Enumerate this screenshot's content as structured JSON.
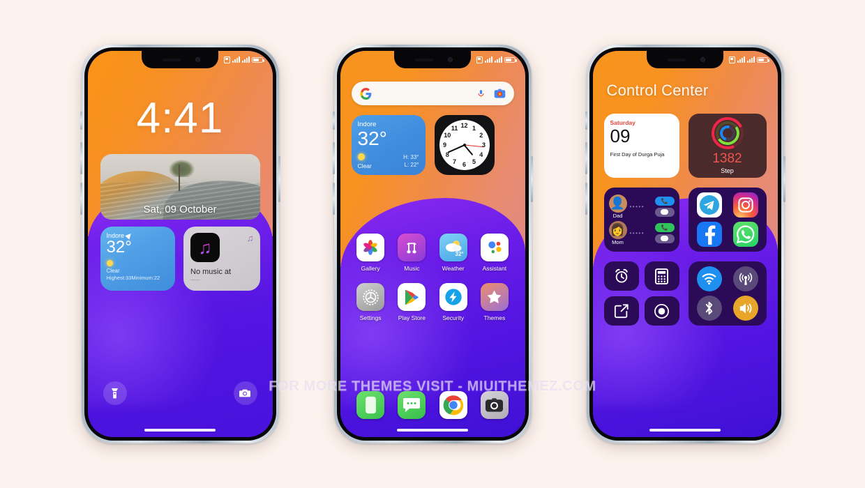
{
  "watermark": "FOR MORE THEMES VISIT - MIUITHEMEZ.COM",
  "colors": {
    "page_background": "#FDF3EE",
    "wallpaper_orange": "#F7941D",
    "wallpaper_purple": "#5415E2",
    "accent_blue": "#3F8CDD",
    "accent_red": "#E0483E",
    "toggle_on_blue": "#1E90F0",
    "toggle_on_orange": "#E8A52A"
  },
  "lock_screen": {
    "name": "Lock Screen",
    "status_bar": {
      "sim_icon": "sim-icon",
      "signal_icon": "signal-bars-icon",
      "battery_icon": "battery-icon"
    },
    "time": "4:41",
    "photo_widget": {
      "date": "Sat, 09 October"
    },
    "weather_widget": {
      "city": "Indore",
      "location_icon": "location-arrow-icon",
      "temperature": "32°",
      "condition_icon": "sun-icon",
      "condition": "Clear",
      "high_low": "Highest:33Minimum:22"
    },
    "music_widget": {
      "app_icon": "music-note-icon",
      "badge_icon": "music-note-badge-icon",
      "title": "No music at",
      "subtitle": "——"
    },
    "actions": {
      "flashlight_icon": "flashlight-icon",
      "camera_icon": "camera-icon"
    },
    "home_indicator": "home-indicator"
  },
  "home_screen": {
    "name": "Home Screen",
    "search": {
      "google_icon": "google-g-icon",
      "placeholder": "",
      "mic_icon": "microphone-icon",
      "lens_icon": "google-lens-icon"
    },
    "weather_widget": {
      "city": "Indore",
      "temperature": "32°",
      "condition_icon": "sun-cloud-icon",
      "condition": "Clear",
      "high": "H: 33°",
      "low": "L: 22°"
    },
    "clock_widget": {
      "name": "analog-clock",
      "numbers": [
        "12",
        "1",
        "2",
        "3",
        "4",
        "5",
        "6",
        "7",
        "8",
        "9",
        "10",
        "11"
      ],
      "hour_angle_deg": 140,
      "minute_angle_deg": 246,
      "second_angle_deg": 96
    },
    "apps": [
      {
        "label": "Gallery",
        "icon": "gallery-icon"
      },
      {
        "label": "Music",
        "icon": "music-icon"
      },
      {
        "label": "Weather",
        "icon": "weather-icon",
        "badge": "32°"
      },
      {
        "label": "Assistant",
        "icon": "google-assistant-icon"
      },
      {
        "label": "Settings",
        "icon": "settings-gear-icon"
      },
      {
        "label": "Play Store",
        "icon": "play-store-icon"
      },
      {
        "label": "Security",
        "icon": "security-shield-icon"
      },
      {
        "label": "Themes",
        "icon": "themes-star-icon"
      }
    ],
    "dock": [
      {
        "label": "Phone",
        "icon": "phone-icon"
      },
      {
        "label": "Messages",
        "icon": "messages-icon"
      },
      {
        "label": "Chrome",
        "icon": "chrome-icon"
      },
      {
        "label": "Camera",
        "icon": "camera-app-icon"
      }
    ]
  },
  "control_center": {
    "name": "Control Center",
    "title": "Control Center",
    "calendar_widget": {
      "day_of_week": "Saturday",
      "day_number": "09",
      "event": "First Day of Durga Puja"
    },
    "fitness_widget": {
      "rings_icon": "activity-rings-icon",
      "steps": "1382",
      "unit": "Step"
    },
    "contacts_widget": [
      {
        "name": "Dad",
        "avatar_icon": "avatar-man-icon",
        "call_icon": "phone-call-icon",
        "call_color": "#1E90F0",
        "message_icon": "message-bubble-icon"
      },
      {
        "name": "Mom",
        "avatar_icon": "avatar-woman-icon",
        "call_icon": "phone-call-icon",
        "call_color": "#2FC45A",
        "message_icon": "message-bubble-icon"
      }
    ],
    "social_apps": [
      {
        "label": "Telegram",
        "icon": "telegram-icon"
      },
      {
        "label": "Instagram",
        "icon": "instagram-icon"
      },
      {
        "label": "Facebook",
        "icon": "facebook-icon"
      },
      {
        "label": "WhatsApp",
        "icon": "whatsapp-icon"
      }
    ],
    "tools": [
      {
        "label": "Alarm",
        "icon": "alarm-clock-icon"
      },
      {
        "label": "Calculator",
        "icon": "calculator-icon"
      },
      {
        "label": "Notes",
        "icon": "notes-edit-icon"
      },
      {
        "label": "Recorder",
        "icon": "record-icon"
      }
    ],
    "toggles": [
      {
        "label": "Wi-Fi",
        "icon": "wifi-icon",
        "state": "on",
        "color": "#1E90F0"
      },
      {
        "label": "Mobile Data",
        "icon": "cell-signal-icon",
        "state": "off",
        "color": "#5a4a7a"
      },
      {
        "label": "Bluetooth",
        "icon": "bluetooth-icon",
        "state": "off",
        "color": "#5a4a7a"
      },
      {
        "label": "Volume",
        "icon": "volume-icon",
        "state": "on",
        "color": "#E8A52A"
      }
    ]
  }
}
